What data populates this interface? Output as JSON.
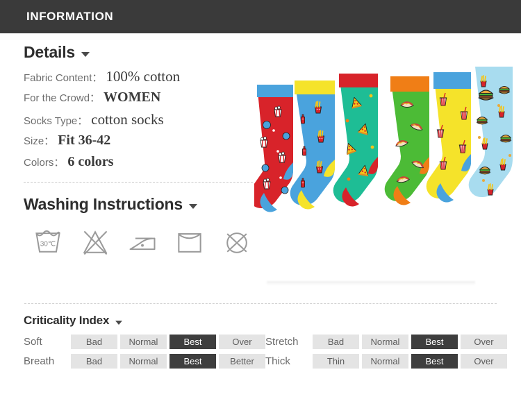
{
  "header": {
    "title": "INFORMATION",
    "background": "#3a3a3a",
    "text_color": "#ffffff"
  },
  "details": {
    "heading": "Details",
    "caret_icon": "chevron-down-icon",
    "rows": [
      {
        "label": "Fabric Content：",
        "value": "100% cotton",
        "bold": false
      },
      {
        "label": "For the Crowd：",
        "value": "WOMEN",
        "bold": true
      },
      {
        "label": "Socks Type：",
        "value": "cotton socks",
        "bold": false
      },
      {
        "label": "Size：",
        "value": "Fit 36-42",
        "bold": true
      },
      {
        "label": "Colors：",
        "value": "6 colors",
        "bold": true
      }
    ]
  },
  "washing": {
    "heading": "Washing Instructions",
    "caret_icon": "chevron-down-icon",
    "icons": [
      {
        "name": "wash-30c-icon",
        "label": "30°C"
      },
      {
        "name": "do-not-bleach-icon",
        "label": ""
      },
      {
        "name": "iron-low-icon",
        "label": ""
      },
      {
        "name": "line-dry-icon",
        "label": ""
      },
      {
        "name": "do-not-dry-clean-icon",
        "label": ""
      }
    ]
  },
  "product_image": {
    "name": "socks-product-photo",
    "socks": [
      {
        "body": "#d8232a",
        "cuff": "#4aa3dd",
        "heel": "#4aa3dd",
        "toe": "#4aa3dd",
        "pattern": "popcorn"
      },
      {
        "body": "#4aa3dd",
        "cuff": "#f5e32a",
        "heel": "#f5e32a",
        "toe": "#f5e32a",
        "pattern": "fries-and-ketchup"
      },
      {
        "body": "#1ebd95",
        "cuff": "#d8232a",
        "heel": "#d8232a",
        "toe": "#d8232a",
        "pattern": "pizza"
      },
      {
        "body": "#4cbb36",
        "cuff": "#f07e16",
        "heel": "#f07e16",
        "toe": "#f07e16",
        "pattern": "hot-dog"
      },
      {
        "body": "#f5e32a",
        "cuff": "#4aa3dd",
        "heel": "#4aa3dd",
        "toe": "#4aa3dd",
        "pattern": "soda-cup"
      },
      {
        "body": "#a8dcef",
        "cuff": "#a8dcef",
        "heel": "#a8dcef",
        "toe": "#a8dcef",
        "pattern": "burger-and-fries"
      }
    ]
  },
  "criticality": {
    "heading": "Criticality Index",
    "caret_icon": "chevron-down-icon",
    "rows": [
      {
        "name": "Soft",
        "options": [
          "Bad",
          "Normal",
          "Best",
          "Over"
        ],
        "active": 2
      },
      {
        "name": "Stretch",
        "options": [
          "Bad",
          "Normal",
          "Best",
          "Over"
        ],
        "active": 2
      },
      {
        "name": "Breath",
        "options": [
          "Bad",
          "Normal",
          "Best",
          "Better"
        ],
        "active": 2
      },
      {
        "name": "Thick",
        "options": [
          "Thin",
          "Normal",
          "Best",
          "Over"
        ],
        "active": 2
      }
    ],
    "active_color": "#3e3e3e",
    "inactive_color": "#e4e4e4"
  }
}
